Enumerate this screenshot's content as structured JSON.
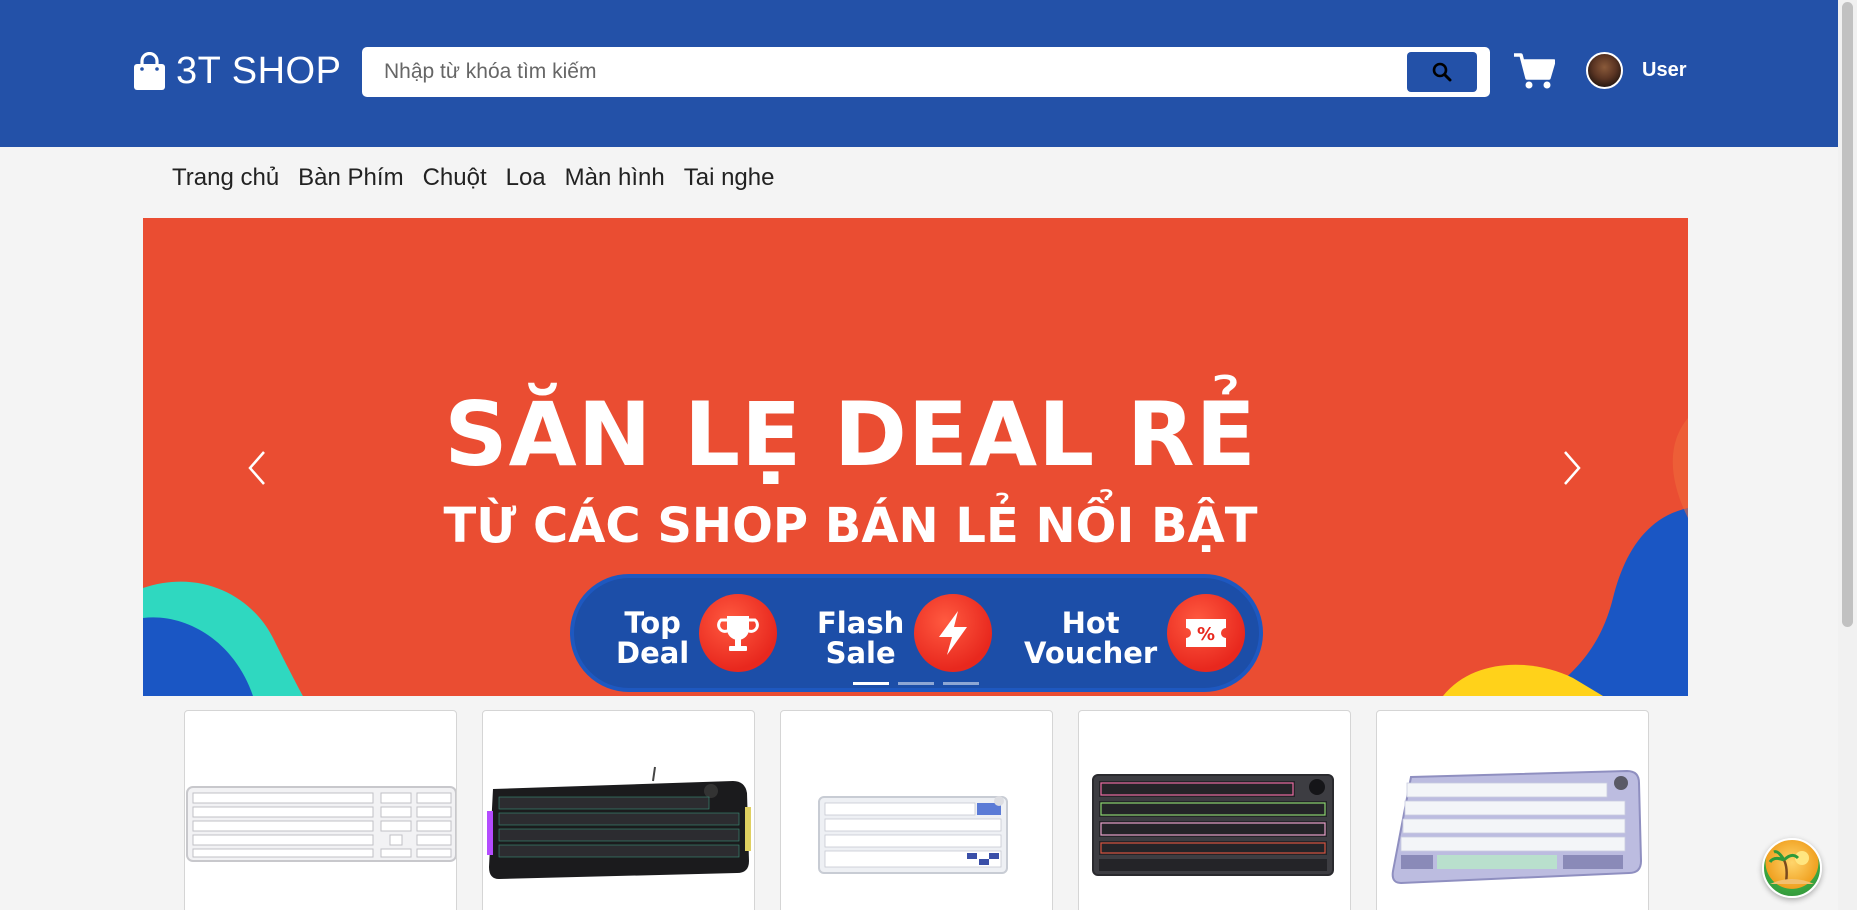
{
  "header": {
    "logo_text": "3T SHOP",
    "search_placeholder": "Nhập từ khóa tìm kiếm",
    "user_name": "User",
    "brand_color": "#2351a8"
  },
  "nav": {
    "items": [
      "Trang chủ",
      "Bàn Phím",
      "Chuột",
      "Loa",
      "Màn hình",
      "Tai nghe"
    ]
  },
  "banner": {
    "headline": "SĂN LẸ DEAL RẺ",
    "subheadline": "TỪ CÁC SHOP BÁN LẺ NỔI BẬT",
    "badges": [
      {
        "label_line1": "Top",
        "label_line2": "Deal",
        "icon": "trophy-icon"
      },
      {
        "label_line1": "Flash",
        "label_line2": "Sale",
        "icon": "lightning-icon"
      },
      {
        "label_line1": "Hot",
        "label_line2": "Voucher",
        "icon": "voucher-icon"
      }
    ],
    "slide_count": 3,
    "active_slide": 1,
    "background_color": "#ea4d32"
  },
  "products": [
    {
      "image": "white-full-size-keyboard"
    },
    {
      "image": "black-rgb-gaming-keyboard"
    },
    {
      "image": "white-tkl-mechanical-keyboard"
    },
    {
      "image": "dark-rgb-75-keyboard"
    },
    {
      "image": "pastel-75-keyboard-with-knob"
    }
  ]
}
